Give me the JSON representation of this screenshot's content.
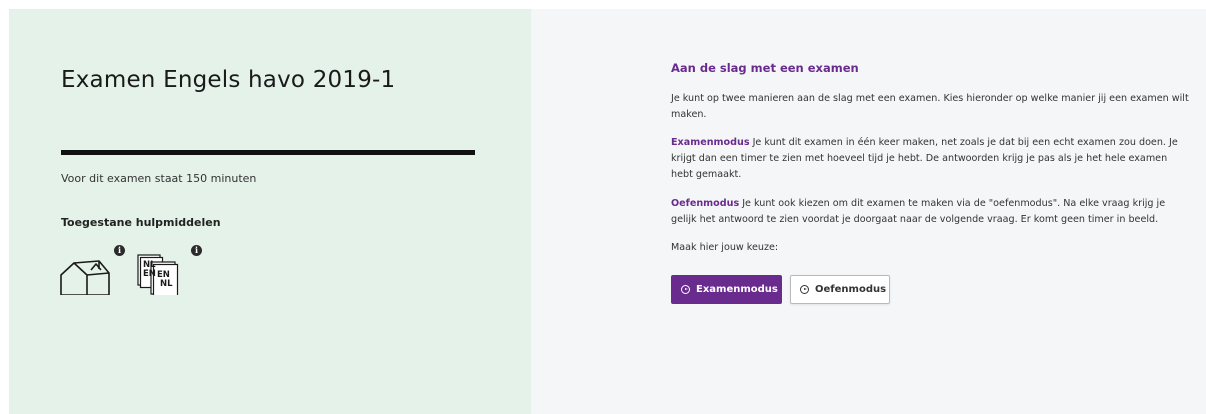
{
  "exam": {
    "title": "Examen Engels havo 2019-1",
    "duration_text": "Voor dit examen staat 150 minuten",
    "aids_heading": "Toegestane hulpmiddelen",
    "aids": [
      {
        "icon": "school-building-icon",
        "info": "i"
      },
      {
        "icon": "dictionary-nl-en-icon",
        "info": "i",
        "labels": [
          "NL",
          "EN",
          "EN",
          "NL"
        ]
      }
    ]
  },
  "start": {
    "heading": "Aan de slag met een examen",
    "intro": "Je kunt op twee manieren aan de slag met een examen. Kies hieronder op welke manier jij een examen wilt maken.",
    "exam_mode_term": "Examenmodus",
    "exam_mode_text": " Je kunt dit examen in één keer maken, net zoals je dat bij een echt examen zou doen. Je krijgt dan een timer te zien met hoeveel tijd je hebt. De antwoorden krijg je pas als je het hele examen hebt gemaakt.",
    "practice_mode_term": "Oefenmodus",
    "practice_mode_text": " Je kunt ook kiezen om dit examen te maken via de \"oefenmodus\". Na elke vraag krijg je gelijk het antwoord te zien voordat je doorgaat naar de volgende vraag. Er komt geen timer in beeld.",
    "choice_prompt": "Maak hier jouw keuze:",
    "exam_mode_button": "Examenmodus",
    "practice_mode_button": "Oefenmodus"
  },
  "colors": {
    "accent": "#6a2b8f",
    "left_panel_bg": "#e5f2ea",
    "right_panel_bg": "#f5f6f8"
  }
}
